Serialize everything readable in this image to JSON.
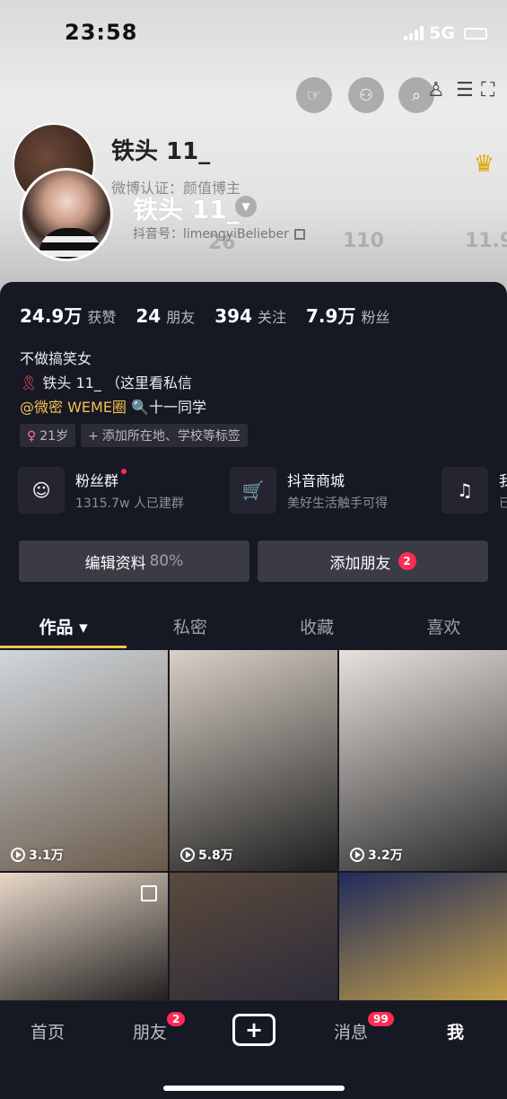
{
  "status": {
    "time": "23:58",
    "network": "5G"
  },
  "header": {
    "name_back": "铁头 11_",
    "weibo": "微博认证：颜值博主",
    "name": "铁头 11_",
    "douyin_id": "抖音号：limengyiBelieber",
    "ghost_numbers": [
      "26",
      "110",
      "11.9"
    ]
  },
  "stats": [
    {
      "num": "24.9万",
      "label": "获赞"
    },
    {
      "num": "24",
      "label": "朋友"
    },
    {
      "num": "394",
      "label": "关注"
    },
    {
      "num": "7.9万",
      "label": "粉丝"
    }
  ],
  "bio": {
    "line1": "不做搞笑女",
    "line2": "铁头 11_ （这里看私信",
    "line3_hl": "@微密 WEME圈",
    "line3_rest": "十一同学"
  },
  "tags": {
    "age": "21岁",
    "add": "添加所在地、学校等标签"
  },
  "features": [
    {
      "icon": "fan-group-icon",
      "title": "粉丝群",
      "sub": "1315.7w 人已建群"
    },
    {
      "icon": "cart-icon",
      "title": "抖音商城",
      "sub": "美好生活触手可得"
    },
    {
      "icon": "music-note-icon",
      "title": "我",
      "sub": "已"
    }
  ],
  "actions": {
    "edit": "编辑资料",
    "edit_pct": "80%",
    "add_friend": "添加朋友",
    "add_friend_badge": "2"
  },
  "tabs": [
    "作品 ▾",
    "私密",
    "收藏",
    "喜欢"
  ],
  "videos": [
    {
      "plays": "3.1万",
      "color1": "#cfd6dc",
      "color2": "#6a5a4a"
    },
    {
      "plays": "5.8万",
      "color1": "#d8d0c6",
      "color2": "#1e1e1e"
    },
    {
      "plays": "3.2万",
      "color1": "#e7e1dc",
      "color2": "#2a2a2a"
    },
    {
      "plays": "",
      "color1": "#e9d8c9",
      "color2": "#1a1a1a"
    },
    {
      "plays": "",
      "color1": "#5b4a3c",
      "color2": "#2b2a3a"
    },
    {
      "plays": "",
      "color1": "#1f2b5a",
      "color2": "#c9a34a"
    }
  ],
  "nav": {
    "home": "首页",
    "friends": "朋友",
    "friends_badge": "2",
    "messages": "消息",
    "messages_badge": "99",
    "me": "我"
  }
}
